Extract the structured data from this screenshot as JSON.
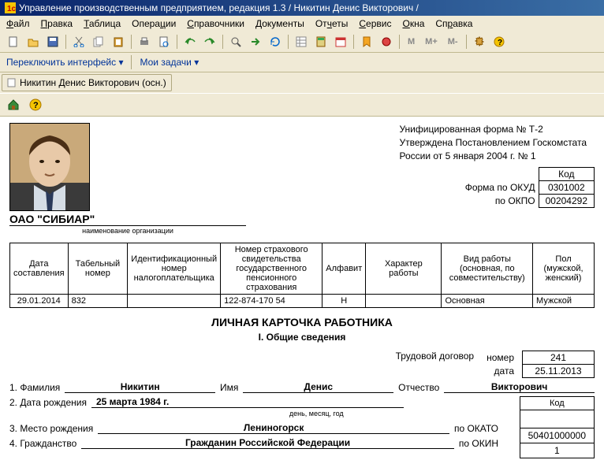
{
  "title": "Управление производственным предприятием, редакция 1.3 / Никитин Денис Викторович /",
  "menu": {
    "file": "Файл",
    "edit": "Правка",
    "table": "Таблица",
    "ops": "Операции",
    "ref": "Справочники",
    "doc": "Документы",
    "rep": "Отчеты",
    "svc": "Сервис",
    "win": "Окна",
    "help": "Справка"
  },
  "subbar": {
    "switch": "Переключить интерфейс",
    "tasks": "Мои задачи"
  },
  "tab": "Никитин Денис Викторович (осн.)",
  "approval": {
    "l1": "Унифицированная форма № Т-2",
    "l2": "Утверждена Постановлением Госкомстата",
    "l3": "России от 5 января 2004 г. № 1"
  },
  "codes": {
    "code_hdr": "Код",
    "okud_label": "Форма по ОКУД",
    "okud": "0301002",
    "okpo_label": "по ОКПО",
    "okpo": "00204292"
  },
  "company": "ОАО \"СИБИАР\"",
  "company_hint": "наименование организации",
  "headers": {
    "date": "Дата составления",
    "tab": "Табельный номер",
    "inn": "Идентификационный номер налогоплательщика",
    "snils": "Номер страхового свидетельства государственного пенсионного страхования",
    "alpha": "Алфавит",
    "nature": "Характер работы",
    "type": "Вид работы (основная, по совместительству)",
    "sex": "Пол (мужской, женский)"
  },
  "row": {
    "date": "29.01.2014",
    "tab": "832",
    "inn": "",
    "snils": "122-874-170 54",
    "alpha": "Н",
    "nature": "",
    "type": "Основная",
    "sex": "Мужской"
  },
  "card_title": "ЛИЧНАЯ КАРТОЧКА РАБОТНИКА",
  "section1": "I. Общие сведения",
  "contract": {
    "label": "Трудовой договор",
    "num_label": "номер",
    "num": "241",
    "date_label": "дата",
    "date": "25.11.2013"
  },
  "fields": {
    "fam_label": "1. Фамилия",
    "fam": "Никитин",
    "name_label": "Имя",
    "name": "Денис",
    "patr_label": "Отчество",
    "patr": "Викторович",
    "dob_label": "2. Дата рождения",
    "dob": "25 марта 1984 г.",
    "dob_hint": "день, месяц, год",
    "pob_label": "3. Место рождения",
    "pob": "Лениногорск",
    "okato_label": "по ОКАТО",
    "okato": "50401000000",
    "cit_label": "4. Гражданство",
    "cit": "Гражданин Российской Федерации",
    "okin_label": "по ОКИН",
    "okin": "1",
    "code_label": "Код"
  },
  "toolbar_text": {
    "m": "M",
    "mplus": "M+",
    "mminus": "M-"
  }
}
